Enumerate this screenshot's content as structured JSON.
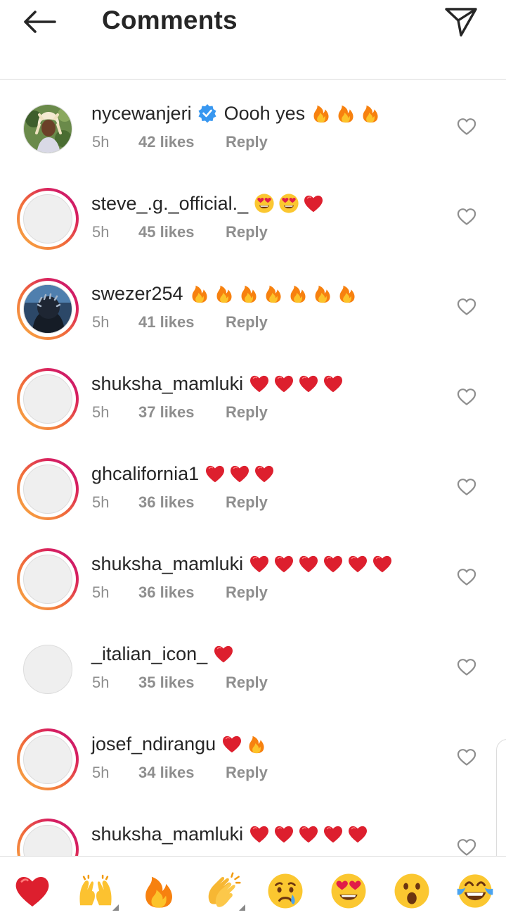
{
  "header": {
    "title": "Comments"
  },
  "comments": [
    {
      "username": "nycewanjeri",
      "verified": true,
      "text": "Oooh yes",
      "emojis": [
        "fire",
        "fire",
        "fire"
      ],
      "time": "5h",
      "likes": "42 likes",
      "reply": "Reply",
      "avatar": "photo-blonde",
      "story": false
    },
    {
      "username": "steve_.g._official._",
      "verified": false,
      "text": "",
      "emojis": [
        "heart-eyes",
        "heart-eyes",
        "heart"
      ],
      "time": "5h",
      "likes": "45 likes",
      "reply": "Reply",
      "avatar": "blank",
      "story": true
    },
    {
      "username": "swezer254",
      "verified": false,
      "text": "",
      "emojis": [
        "fire",
        "fire",
        "fire",
        "fire",
        "fire",
        "fire",
        "fire"
      ],
      "time": "5h",
      "likes": "41 likes",
      "reply": "Reply",
      "avatar": "photo-dark",
      "story": true
    },
    {
      "username": "shuksha_mamluki",
      "verified": false,
      "text": "",
      "emojis": [
        "heart",
        "heart",
        "heart",
        "heart"
      ],
      "time": "5h",
      "likes": "37 likes",
      "reply": "Reply",
      "avatar": "blank",
      "story": true
    },
    {
      "username": "ghcalifornia1",
      "verified": false,
      "text": "",
      "emojis": [
        "heart",
        "heart",
        "heart"
      ],
      "time": "5h",
      "likes": "36 likes",
      "reply": "Reply",
      "avatar": "blank",
      "story": true
    },
    {
      "username": "shuksha_mamluki",
      "verified": false,
      "text": "",
      "emojis": [
        "heart",
        "heart",
        "heart",
        "heart",
        "heart",
        "heart"
      ],
      "time": "5h",
      "likes": "36 likes",
      "reply": "Reply",
      "avatar": "blank",
      "story": true
    },
    {
      "username": "_italian_icon_",
      "verified": false,
      "text": "",
      "emojis": [
        "heart"
      ],
      "time": "5h",
      "likes": "35 likes",
      "reply": "Reply",
      "avatar": "blank",
      "story": false
    },
    {
      "username": "josef_ndirangu",
      "verified": false,
      "text": "",
      "emojis": [
        "heart",
        "fire"
      ],
      "time": "5h",
      "likes": "34 likes",
      "reply": "Reply",
      "avatar": "blank",
      "story": true
    },
    {
      "username": "shuksha_mamluki",
      "verified": false,
      "text": "",
      "emojis": [
        "heart",
        "heart",
        "heart",
        "heart",
        "heart"
      ],
      "time": "",
      "likes": "",
      "reply": "",
      "avatar": "blank",
      "story": true
    }
  ],
  "reactions": [
    "heart",
    "raising-hands",
    "fire",
    "clapping-hands",
    "crying-face",
    "heart-eyes",
    "astonished-face",
    "tears-of-joy"
  ],
  "colors": {
    "text": "#262626",
    "meta": "#8e8e8e",
    "verified": "#3897f0",
    "story_ring_start": "#f9b244",
    "story_ring_end": "#c21975"
  }
}
